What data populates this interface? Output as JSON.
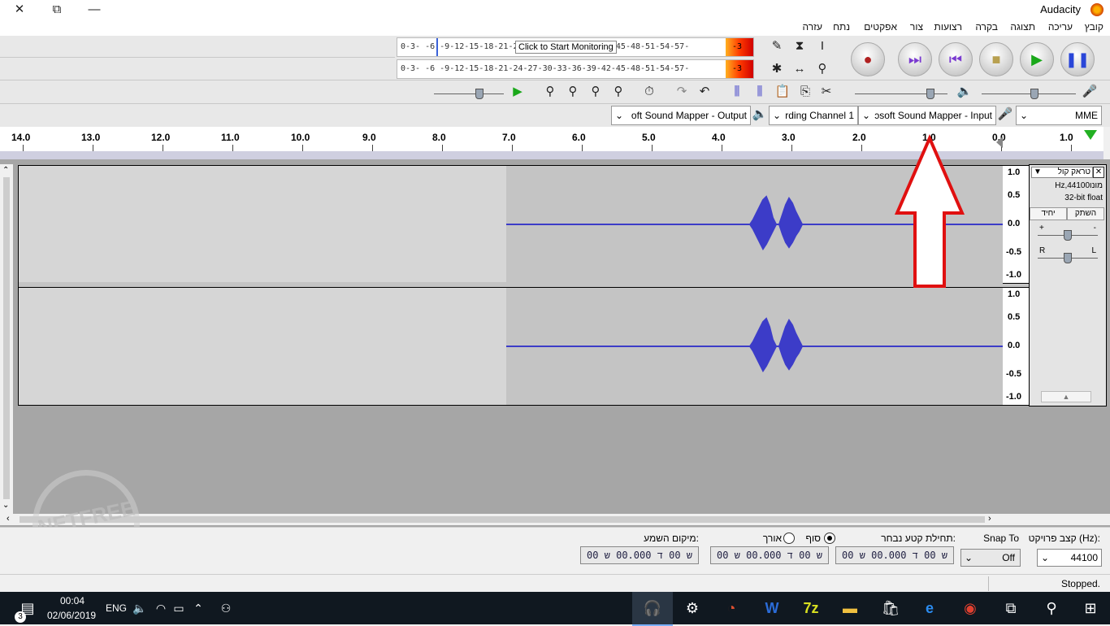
{
  "window": {
    "title": "Audacity",
    "buttons": {
      "close": "✕",
      "restore": "⧉",
      "minimize": "—"
    }
  },
  "menu": [
    "קובץ",
    "עריכה",
    "תצוגה",
    "בקרה",
    "רצועות",
    "צור",
    "אפקטים",
    "נתח",
    "עזרה"
  ],
  "meters": {
    "record_scale": "0-3- -6 -9-12-15-18-21-24-27-30-33-36-39-42-45-48-51-54-57-",
    "play_scale": "0-3- -6 -9-12-15-18-21-24-27-30-33-36-39-42-45-48-51-54-57-",
    "record_hot": "-3",
    "play_hot": "-3",
    "tooltip": "Click to Start Monitoring"
  },
  "devices": {
    "host": "MME",
    "input": "ɔsoft Sound Mapper - Input",
    "channels": "rding Channel 1",
    "output": "oft Sound Mapper - Output"
  },
  "ruler": {
    "labels": [
      "1.0",
      "0.0",
      "1.0",
      "2.0",
      "3.0",
      "4.0",
      "5.0",
      "6.0",
      "7.0",
      "8.0",
      "9.0",
      "10.0",
      "11.0",
      "12.0",
      "13.0",
      "14.0"
    ]
  },
  "track": {
    "name": "טראק קול",
    "format1": "Hz,44100מונו",
    "format2": "32-bit float",
    "mute": "השתק",
    "solo": "יחיד",
    "gain_minus": "-",
    "gain_plus": "+",
    "pan_left": "L",
    "pan_right": "R",
    "vruler_labels": [
      "1.0",
      "0.5",
      "0.0",
      "-0.5",
      "-1.0"
    ]
  },
  "selection": {
    "rate_label": "קצב פרויקט (Hz):",
    "rate_value": "44100",
    "snap_label": "Snap To",
    "snap_value": "Off",
    "start_label": "תחילת קטע נבחר:",
    "end_option": "סוף",
    "length_option": "אורך",
    "audio_pos_label": "מיקום השמע:",
    "time_value": "00 ש 00 ד 00.000 ש"
  },
  "status": {
    "text": "Stopped."
  },
  "taskbar": {
    "time": "00:04",
    "date": "02/06/2019",
    "lang": "ENG",
    "notifications": "3"
  },
  "watermark": {
    "text": "NETFREE"
  },
  "colors": {
    "waveform": "#3c3cc8",
    "record": "#b02020",
    "play": "#1aa81a",
    "pause": "#2a46d8",
    "arrow": "#e01010"
  }
}
